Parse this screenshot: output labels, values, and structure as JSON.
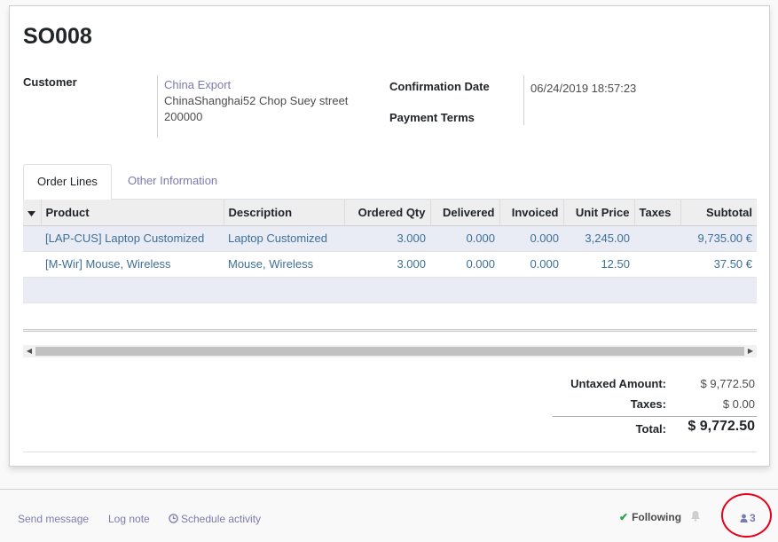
{
  "record": {
    "title": "SO008"
  },
  "form": {
    "customer_label": "Customer",
    "customer_name": "China Export",
    "customer_address_line1": "ChinaShanghai52 Chop Suey street",
    "customer_address_line2": "200000",
    "confirmation_date_label": "Confirmation Date",
    "confirmation_date_value": "06/24/2019 18:57:23",
    "payment_terms_label": "Payment Terms"
  },
  "tabs": [
    {
      "label": "Order Lines",
      "active": true
    },
    {
      "label": "Other Information",
      "active": false
    }
  ],
  "order_lines": {
    "columns": [
      "Product",
      "Description",
      "Ordered Qty",
      "Delivered",
      "Invoiced",
      "Unit Price",
      "Taxes",
      "Subtotal"
    ],
    "rows": [
      {
        "product": "[LAP-CUS] Laptop Customized",
        "description": "Laptop Customized",
        "ordered_qty": "3.000",
        "delivered": "0.000",
        "invoiced": "0.000",
        "unit_price": "3,245.00",
        "taxes": "",
        "subtotal": "9,735.00 €"
      },
      {
        "product": "[M-Wir] Mouse, Wireless",
        "description": "Mouse, Wireless",
        "ordered_qty": "3.000",
        "delivered": "0.000",
        "invoiced": "0.000",
        "unit_price": "12.50",
        "taxes": "",
        "subtotal": "37.50 €"
      }
    ]
  },
  "totals": {
    "untaxed_label": "Untaxed Amount:",
    "untaxed_value": "$ 9,772.50",
    "taxes_label": "Taxes:",
    "taxes_value": "$ 0.00",
    "total_label": "Total:",
    "total_value": "$ 9,772.50"
  },
  "chatter": {
    "send_message": "Send message",
    "log_note": "Log note",
    "schedule_activity": "Schedule activity",
    "following": "Following",
    "followers_count": "3"
  },
  "icons": {
    "sort": "caret-down-icon",
    "schedule": "clock-icon",
    "following": "check-icon",
    "bell": "bell-icon",
    "followers": "user-icon"
  },
  "colors": {
    "link": "#7c7bad",
    "line_text": "#3e6f97",
    "selected_row": "#e9ecf5",
    "highlight_circle": "#e8001c"
  }
}
